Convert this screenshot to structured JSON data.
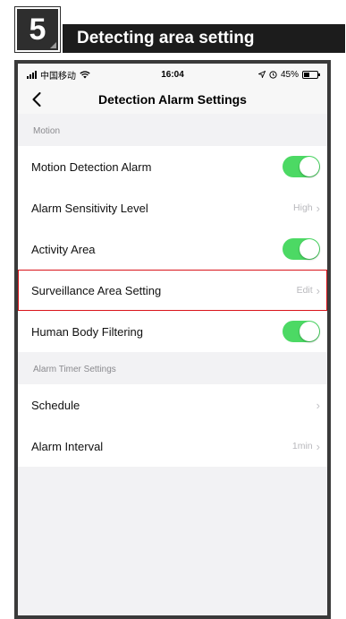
{
  "step": {
    "number": "5",
    "title": "Detecting area setting"
  },
  "status_bar": {
    "carrier": "中国移动",
    "time": "16:04",
    "battery": "45%",
    "battery_level": 0.45
  },
  "nav": {
    "title": "Detection Alarm Settings"
  },
  "sections": [
    {
      "header": "Motion",
      "rows": [
        {
          "label": "Motion Detection Alarm",
          "toggle": true
        },
        {
          "label": "Alarm Sensitivity Level",
          "value": "High"
        },
        {
          "label": "Activity Area",
          "toggle": true
        },
        {
          "label": "Surveillance Area Setting",
          "value": "Edit",
          "highlighted": true
        },
        {
          "label": "Human Body Filtering",
          "toggle": true
        }
      ]
    },
    {
      "header": "Alarm Timer Settings",
      "rows": [
        {
          "label": "Schedule",
          "value": ""
        },
        {
          "label": "Alarm Interval",
          "value": "1min"
        }
      ]
    }
  ],
  "colors": {
    "toggle_on": "#4cd964",
    "highlight": "#d9141a"
  },
  "icons": {
    "back": "chevron-left-icon",
    "row_arrow": "chevron-right-icon"
  }
}
